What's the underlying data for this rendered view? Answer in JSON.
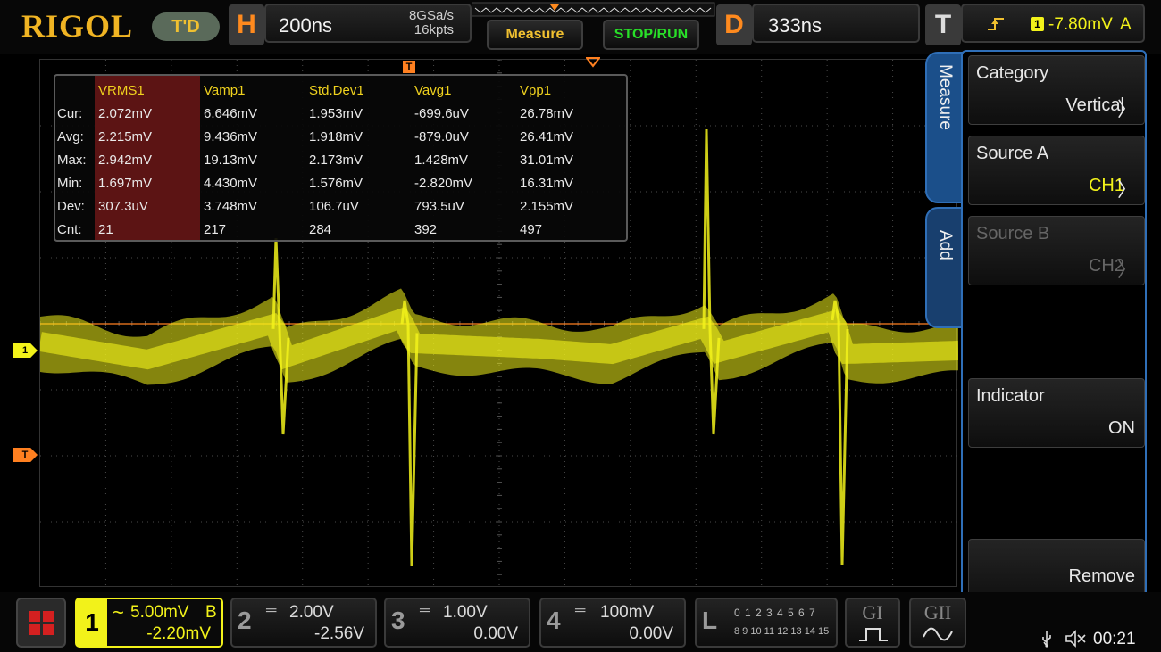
{
  "top": {
    "logo": "RIGOL",
    "run_mode": "T'D",
    "horizontal": {
      "letter": "H",
      "timebase": "200ns",
      "sample_rate": "8GSa/s",
      "memory_depth": "16kpts"
    },
    "measure_button": "Measure",
    "run_stop_button": "STOP/RUN",
    "delay": {
      "letter": "D",
      "value": "333ns"
    },
    "trigger": {
      "letter": "T",
      "source": "1",
      "level": "-7.80mV",
      "mode": "A"
    }
  },
  "measurements": {
    "row_labels": [
      "Cur:",
      "Avg:",
      "Max:",
      "Min:",
      "Dev:",
      "Cnt:"
    ],
    "columns": [
      {
        "header": "VRMS1",
        "values": [
          "2.072mV",
          "2.215mV",
          "2.942mV",
          "1.697mV",
          "307.3uV",
          "21"
        ]
      },
      {
        "header": "Vamp1",
        "values": [
          "6.646mV",
          "9.436mV",
          "19.13mV",
          "4.430mV",
          "3.748mV",
          "217"
        ]
      },
      {
        "header": "Std.Dev1",
        "values": [
          "1.953mV",
          "1.918mV",
          "2.173mV",
          "1.576mV",
          "106.7uV",
          "284"
        ]
      },
      {
        "header": "Vavg1",
        "values": [
          "-699.6uV",
          "-879.0uV",
          "1.428mV",
          "-2.820mV",
          "793.5uV",
          "392"
        ]
      },
      {
        "header": "Vpp1",
        "values": [
          "26.78mV",
          "26.41mV",
          "31.01mV",
          "16.31mV",
          "2.155mV",
          "497"
        ]
      }
    ]
  },
  "markers": {
    "channel1": "1",
    "trigger": "T"
  },
  "side_tabs": [
    "Measure",
    "Add"
  ],
  "menu": {
    "items": [
      {
        "title": "Category",
        "value": "Vertical",
        "chevron": true,
        "disabled": false
      },
      {
        "title": "Source A",
        "value": "CH1",
        "chevron": true,
        "disabled": false
      },
      {
        "title": "Source B",
        "value": "CH2",
        "chevron": true,
        "disabled": true
      },
      {
        "title": "Indicator",
        "value": "ON",
        "chevron": false,
        "disabled": false
      },
      {
        "title": "",
        "value": "Remove",
        "chevron": false,
        "disabled": false
      }
    ]
  },
  "channels": [
    {
      "num": "1",
      "coupling": "~",
      "scale": "5.00mV",
      "bw": "B",
      "offset": "-2.20mV",
      "active": true
    },
    {
      "num": "2",
      "coupling": "═",
      "scale": "2.00V",
      "bw": "",
      "offset": "-2.56V",
      "active": false
    },
    {
      "num": "3",
      "coupling": "═",
      "scale": "1.00V",
      "bw": "",
      "offset": "0.00V",
      "active": false
    },
    {
      "num": "4",
      "coupling": "═",
      "scale": "100mV",
      "bw": "",
      "offset": "0.00V",
      "active": false
    }
  ],
  "logic": {
    "letter": "L",
    "row1": "0 1 2 3 4 5 6 7",
    "row2": "8 9 10 11 12 13 14 15"
  },
  "generators": [
    "GI",
    "GII"
  ],
  "status": {
    "time": "00:21"
  },
  "colors": {
    "ch1": "#f2f21a",
    "trigger": "#ff8020",
    "accent_blue": "#2f6fb8",
    "selected_column": "#5c1414",
    "brand": "#f0b423"
  }
}
